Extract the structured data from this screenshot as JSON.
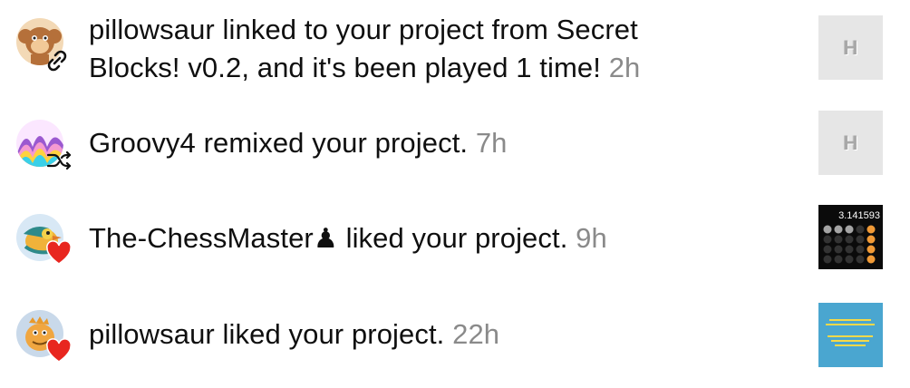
{
  "notifications": [
    {
      "avatar": "monkey-avatar",
      "badge": "link-icon",
      "message": "pillowsaur linked to your project from Secret",
      "message_cont": "Blocks! v0.2, and it's been played 1 time!",
      "time": "2h",
      "thumbnail": {
        "type": "placeholder",
        "text": "H"
      }
    },
    {
      "avatar": "rainbow-wave-avatar",
      "badge": "remix-icon",
      "message": "Groovy4 remixed your project.",
      "time": "7h",
      "thumbnail": {
        "type": "placeholder",
        "text": "H"
      }
    },
    {
      "avatar": "bird-avatar",
      "badge": "heart-icon",
      "user": "The-ChessMaster",
      "user_symbol": "♟",
      "message_rest": "liked your project.",
      "time": "9h",
      "thumbnail": {
        "type": "calculator",
        "display": "3.141593"
      }
    },
    {
      "avatar": "dino-avatar",
      "badge": "heart-icon",
      "message": "pillowsaur liked your project.",
      "time": "22h",
      "thumbnail": {
        "type": "image",
        "color": "#4aa6d0"
      }
    }
  ],
  "colors": {
    "text": "#0f0f0f",
    "time": "#8a8a8a",
    "heart": "#e8261f",
    "thumb_placeholder": "#e6e6e6"
  }
}
